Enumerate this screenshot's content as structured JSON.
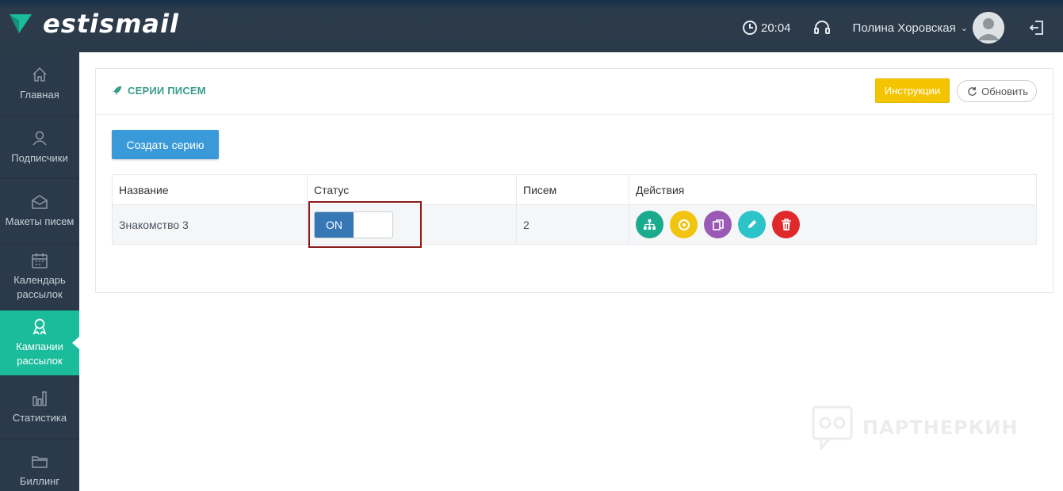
{
  "app": {
    "name": "estismail"
  },
  "header": {
    "time": "20:04",
    "user_name": "Полина Хоровская"
  },
  "sidebar": {
    "items": [
      {
        "label": "Главная",
        "icon": "home-icon"
      },
      {
        "label": "Подписчики",
        "icon": "users-icon"
      },
      {
        "label": "Макеты писем",
        "icon": "envelope-icon"
      },
      {
        "label": "Календарь рассылок",
        "icon": "calendar-icon"
      },
      {
        "label": "Кампании рассылок",
        "icon": "badge-icon",
        "active": true
      },
      {
        "label": "Статистика",
        "icon": "bar-chart-icon"
      },
      {
        "label": "Биллинг",
        "icon": "folder-icon"
      }
    ]
  },
  "panel": {
    "title": "СЕРИИ ПИСЕМ",
    "instructions_label": "Инструкции",
    "refresh_label": "Обновить",
    "create_label": "Создать серию"
  },
  "table": {
    "headers": [
      "Название",
      "Статус",
      "Писем",
      "Действия"
    ],
    "rows": [
      {
        "name": "Знакомство 3",
        "status": "ON",
        "letters": "2"
      }
    ]
  },
  "actions": [
    {
      "icon": "sitemap-icon",
      "color": "#1aab8e"
    },
    {
      "icon": "target-icon",
      "color": "#f1c40f"
    },
    {
      "icon": "copy-icon",
      "color": "#9b59b6"
    },
    {
      "icon": "pencil-icon",
      "color": "#2cc3c9"
    },
    {
      "icon": "trash-icon",
      "color": "#e0292b"
    }
  ],
  "watermark": {
    "text": "ПАРТНЕРКИН"
  },
  "colors": {
    "accent": "#1abc9c",
    "primary": "#3a9ad9",
    "toggle_on": "#3677b5",
    "warning": "#f5c400",
    "highlight": "#8b1a1a"
  }
}
